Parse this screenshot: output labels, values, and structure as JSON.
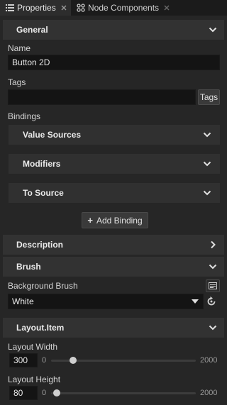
{
  "tabs": [
    {
      "label": "Properties",
      "icon": "list-icon",
      "active": true
    },
    {
      "label": "Node Components",
      "icon": "components-icon",
      "active": false
    }
  ],
  "sections": {
    "general": {
      "title": "General"
    },
    "description": {
      "title": "Description"
    },
    "brush": {
      "title": "Brush"
    },
    "layout_item": {
      "title": "Layout.Item"
    }
  },
  "general": {
    "name_label": "Name",
    "name_value": "Button 2D",
    "tags_label": "Tags",
    "tags_value": "",
    "tags_button": "Tags",
    "bindings_label": "Bindings",
    "binding_groups": [
      "Value Sources",
      "Modifiers",
      "To Source"
    ],
    "add_binding_label": "Add Binding"
  },
  "brush": {
    "background_label": "Background Brush",
    "background_value": "White"
  },
  "layout": {
    "width_label": "Layout Width",
    "width_value": "300",
    "width_min": "0",
    "width_max": "2000",
    "width_fraction": 0.15,
    "height_label": "Layout Height",
    "height_value": "80",
    "height_min": "0",
    "height_max": "2000",
    "height_fraction": 0.04
  },
  "colors": {
    "panel_bg": "#262626",
    "header_bg": "#323232",
    "field_bg": "#141414"
  }
}
